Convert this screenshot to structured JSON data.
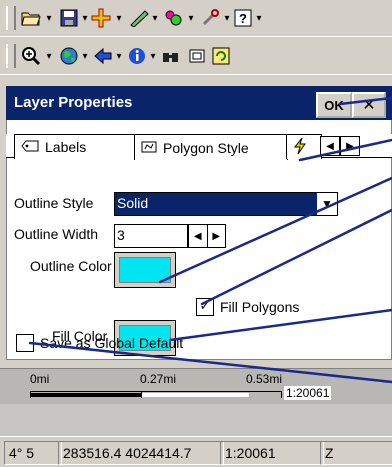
{
  "toolbar1": {
    "icons": [
      "open-folder-icon",
      "save-icon",
      "add-layer-icon",
      "draw-icon",
      "layer-options-icon",
      "tools-icon",
      "help-icon"
    ]
  },
  "toolbar2": {
    "icons": [
      "zoom-icon",
      "globe-icon",
      "back-arrow-icon",
      "info-icon",
      "find-icon",
      "display-box-icon",
      "refresh-icon"
    ]
  },
  "dialog": {
    "title": "Layer Properties",
    "ok_label": "OK",
    "close_label": "✕",
    "tabs": [
      {
        "label": "Labels",
        "icon": "label-tag-icon"
      },
      {
        "label": "Polygon Style",
        "icon": "polygon-style-icon"
      },
      {
        "label": "",
        "icon": "lightning-icon"
      }
    ]
  },
  "form": {
    "outline_style": {
      "label": "Outline Style",
      "value": "Solid"
    },
    "outline_width": {
      "label": "Outline Width",
      "value": "3"
    },
    "outline_color": {
      "label": "Outline Color",
      "color": "#00e5f0"
    },
    "fill_polygons": {
      "label": "Fill Polygons",
      "checked": true,
      "check_mark": "✓"
    },
    "fill_color": {
      "label": "Fill Color",
      "color": "#00e5f0"
    },
    "save_default": {
      "label": "Save as Global Default",
      "checked": false
    }
  },
  "scale": {
    "labels": [
      "0mi",
      "0.27mi",
      "0.53mi"
    ],
    "ratio": "1:20061"
  },
  "status": {
    "lon": "4° 5",
    "coords": "283516.4 4024414.7",
    "scale": "1:20061",
    "zone": "Z"
  },
  "colors": {
    "title_bar": "#0a246a",
    "callout_line": "#1a2a8a",
    "swatch": "#00e5f0"
  }
}
